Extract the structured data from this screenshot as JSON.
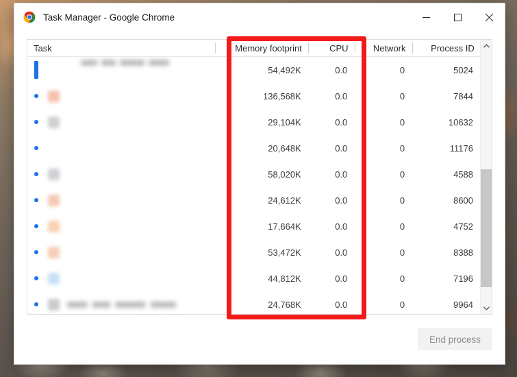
{
  "window": {
    "title": "Task Manager - Google Chrome",
    "app_icon": "chrome-icon",
    "controls": {
      "minimize": "minimize-icon",
      "maximize": "maximize-icon",
      "close": "close-icon"
    }
  },
  "table": {
    "columns": [
      {
        "key": "task",
        "label": "Task",
        "align": "left"
      },
      {
        "key": "memory",
        "label": "Memory footprint",
        "align": "right"
      },
      {
        "key": "cpu",
        "label": "CPU",
        "align": "right"
      },
      {
        "key": "network",
        "label": "Network",
        "align": "right"
      },
      {
        "key": "pid",
        "label": "Process ID",
        "align": "right"
      }
    ],
    "rows": [
      {
        "task": "",
        "memory": "54,492K",
        "cpu": "0.0",
        "network": "0",
        "pid": "5024",
        "selected": true,
        "marker": "bar",
        "redacted": true
      },
      {
        "task": "",
        "memory": "136,568K",
        "cpu": "0.0",
        "network": "0",
        "pid": "7844",
        "selected": false,
        "marker": "dot",
        "redacted": true
      },
      {
        "task": "",
        "memory": "29,104K",
        "cpu": "0.0",
        "network": "0",
        "pid": "10632",
        "selected": false,
        "marker": "dot",
        "redacted": true
      },
      {
        "task": "",
        "memory": "20,648K",
        "cpu": "0.0",
        "network": "0",
        "pid": "11176",
        "selected": false,
        "marker": "dot",
        "redacted": true
      },
      {
        "task": "",
        "memory": "58,020K",
        "cpu": "0.0",
        "network": "0",
        "pid": "4588",
        "selected": false,
        "marker": "dot",
        "redacted": true
      },
      {
        "task": "",
        "memory": "24,612K",
        "cpu": "0.0",
        "network": "0",
        "pid": "8600",
        "selected": false,
        "marker": "dot",
        "redacted": true
      },
      {
        "task": "",
        "memory": "17,664K",
        "cpu": "0.0",
        "network": "0",
        "pid": "4752",
        "selected": false,
        "marker": "dot",
        "redacted": true
      },
      {
        "task": "",
        "memory": "53,472K",
        "cpu": "0.0",
        "network": "0",
        "pid": "8388",
        "selected": false,
        "marker": "dot",
        "redacted": true
      },
      {
        "task": "",
        "memory": "44,812K",
        "cpu": "0.0",
        "network": "0",
        "pid": "7196",
        "selected": false,
        "marker": "dot",
        "redacted": true
      },
      {
        "task": "",
        "memory": "24,768K",
        "cpu": "0.0",
        "network": "0",
        "pid": "9964",
        "selected": false,
        "marker": "dot",
        "redacted": true
      }
    ]
  },
  "scrollbar": {
    "up_arrow": "chevron-up-icon",
    "down_arrow": "chevron-down-icon"
  },
  "footer": {
    "end_process_label": "End process",
    "end_process_enabled": false
  },
  "annotation": {
    "shape": "rectangle",
    "color": "#f41919",
    "highlights": [
      "Memory footprint",
      "CPU"
    ]
  }
}
